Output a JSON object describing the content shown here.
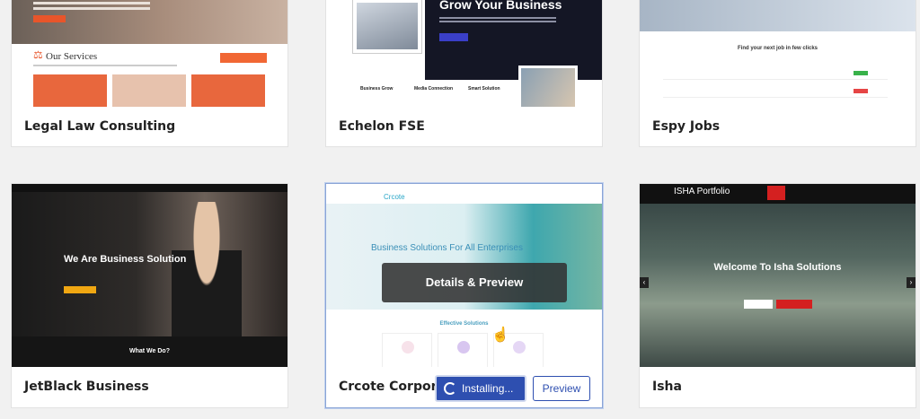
{
  "cards": {
    "legal": {
      "title": "Legal Law Consulting",
      "services_heading": "Our Services"
    },
    "echelon": {
      "title": "Echelon FSE",
      "hero_heading": "Grow Your Business",
      "features": [
        "Business Grow",
        "Media Connection",
        "Smart Solution"
      ]
    },
    "espy": {
      "title": "Espy Jobs",
      "find_heading": "Find your next job in few clicks"
    },
    "jetblack": {
      "title": "JetBlack Business",
      "hero_heading": "We Are Business Solution",
      "what_heading": "What We Do?"
    },
    "crcote": {
      "title": "Crcote Corporat",
      "logo": "Crcote",
      "hero_heading": "Business Solutions For All Enterprises",
      "overlay_label": "Details & Preview",
      "effective_heading": "Effective Solutions",
      "installing_label": "Installing...",
      "preview_label": "Preview"
    },
    "isha": {
      "title": "Isha",
      "logo": "ISHA Portfolio",
      "hero_heading": "Welcome To Isha Solutions"
    }
  },
  "icons": {
    "installing": "spinner-icon",
    "cursor": "hand-pointer-icon"
  },
  "colors": {
    "accent_blue": "#2e4fb0",
    "orange": "#f16734",
    "red": "#d42020"
  }
}
